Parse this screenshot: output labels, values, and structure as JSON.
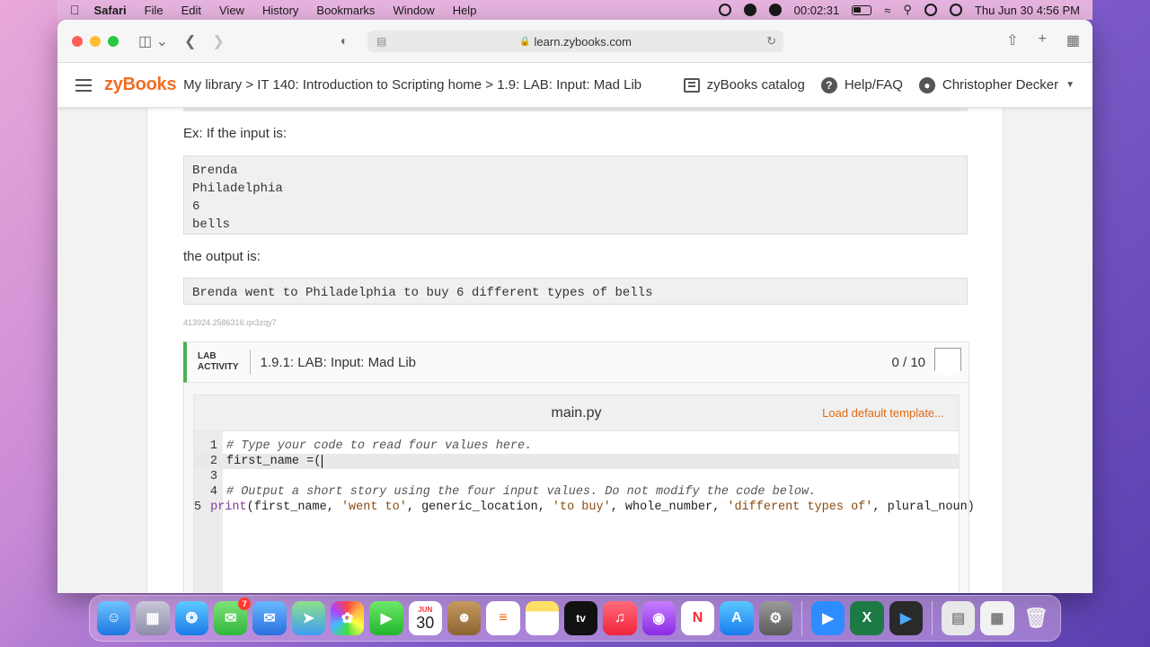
{
  "menubar": {
    "app": "Safari",
    "menus": [
      "File",
      "Edit",
      "View",
      "History",
      "Bookmarks",
      "Window",
      "Help"
    ],
    "timer": "00:02:31",
    "clock": "Thu Jun 30  4:56 PM"
  },
  "browser": {
    "url": "learn.zybooks.com"
  },
  "zybooks": {
    "logo": "zyBooks",
    "breadcrumb": "My library > IT 140: Introduction to Scripting home > 1.9: LAB: Input: Mad Lib",
    "catalog": "zyBooks catalog",
    "help": "Help/FAQ",
    "user": "Christopher Decker"
  },
  "content": {
    "intro": "Ex: If the input is:",
    "input_lines": [
      "Brenda",
      "Philadelphia",
      "6",
      "bells"
    ],
    "output_label": "the output is:",
    "output_text": "Brenda went to Philadelphia to buy 6 different types of bells",
    "item_id": "413924.2586316.qx3zqy7"
  },
  "lab": {
    "tag_line1": "LAB",
    "tag_line2": "ACTIVITY",
    "title": "1.9.1: LAB: Input: Mad Lib",
    "score": "0 / 10"
  },
  "editor": {
    "filename": "main.py",
    "load_default": "Load default template...",
    "line_numbers": [
      "1",
      "2",
      "3",
      "4",
      "5"
    ],
    "line1": "# Type your code to read four values here.",
    "line2": "first_name =(",
    "line3": "",
    "line4": "# Output a short story using the four input values. Do not modify the code below.",
    "line5_print": "print",
    "line5_a": "(first_name, ",
    "line5_s1": "'went to'",
    "line5_b": ", generic_location, ",
    "line5_s2": "'to buy'",
    "line5_c": ", whole_number, ",
    "line5_s3": "'different types of'",
    "line5_d": ", plural_noun)"
  },
  "dock": {
    "messages_badge": "7",
    "calendar_month": "JUN",
    "calendar_day": "30",
    "tv_label": "tv"
  }
}
